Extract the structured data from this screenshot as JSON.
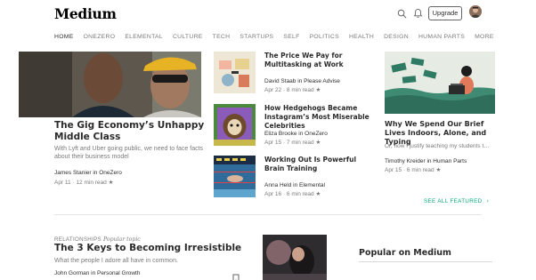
{
  "header": {
    "logo": "Medium",
    "upgrade_label": "Upgrade"
  },
  "nav": [
    "HOME",
    "ONEZERO",
    "ELEMENTAL",
    "CULTURE",
    "TECH",
    "STARTUPS",
    "SELF",
    "POLITICS",
    "HEALTH",
    "DESIGN",
    "HUMAN PARTS",
    "MORE"
  ],
  "featured": {
    "title": "The Gig Economy’s Unhappy Middle Class",
    "subtitle": "With Lyft and Uber going public, we need to face facts about their business model",
    "author": "James Stanier in OneZero",
    "meta": "Apr 11 · 12 min read ★"
  },
  "middle": [
    {
      "title": "The Price We Pay for Multitasking at Work",
      "author": "David Staab in Please Advise",
      "meta": "Apr 22 · 8 min read ★"
    },
    {
      "title": "How Hedgehogs Became Instagram’s Most Miserable Celebrities",
      "author": "Eliza Brooke in OneZero",
      "meta": "Apr 15 · 7 min read ★"
    },
    {
      "title": "Working Out Is Powerful Brain Training",
      "author": "Anna Held in Elemental",
      "meta": "Apr 16 · 6 min read ★"
    }
  ],
  "right": {
    "title": "Why We Spend Our Brief Lives Indoors, Alone, and Typing",
    "subtitle": "Or, how I justify teaching my students t…",
    "author": "Timothy Kreider in Human Parts",
    "meta": "Apr 15 · 6 min read ★"
  },
  "see_all": "SEE ALL FEATURED",
  "bottom": {
    "kicker": "RELATIONSHIPS",
    "kicker_tag": "Popular topic",
    "title": "The 3 Keys to Becoming Irresistible",
    "subtitle": "What the people I adore all have in common.",
    "author": "John Gorman in Personal Growth"
  },
  "popular_heading": "Popular on Medium",
  "colors": {
    "accent": "#03a87c"
  },
  "icons": [
    "search-icon",
    "bell-icon",
    "bookmark-icon",
    "more-icon",
    "chevron-right-icon"
  ]
}
